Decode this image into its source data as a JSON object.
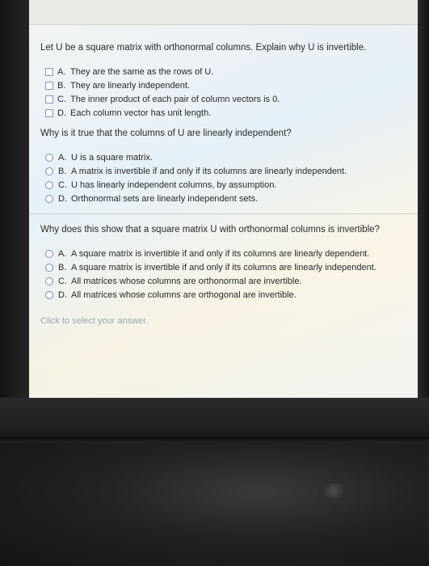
{
  "question1": {
    "text": "Let U be a square matrix with orthonormal columns. Explain why U is invertible.",
    "options": [
      {
        "letter": "A.",
        "text": "They are the same as the rows of U."
      },
      {
        "letter": "B.",
        "text": "They are linearly independent."
      },
      {
        "letter": "C.",
        "text": "The inner product of each pair of column vectors is 0."
      },
      {
        "letter": "D.",
        "text": "Each column vector has unit length."
      }
    ]
  },
  "question2": {
    "text": "Why is it true that the columns of U are linearly independent?",
    "options": [
      {
        "letter": "A.",
        "text": "U is a square matrix."
      },
      {
        "letter": "B.",
        "text": "A matrix is invertible if and only if its columns are linearly independent."
      },
      {
        "letter": "C.",
        "text": "U has linearly independent columns, by assumption."
      },
      {
        "letter": "D.",
        "text": "Orthonormal sets are linearly independent sets."
      }
    ]
  },
  "question3": {
    "text": "Why does this show that a square matrix U with orthonormal columns is invertible?",
    "options": [
      {
        "letter": "A.",
        "text": "A square matrix is invertible if and only if its columns are linearly dependent."
      },
      {
        "letter": "B.",
        "text": "A square matrix is invertible if and only if its columns are linearly independent."
      },
      {
        "letter": "C.",
        "text": "All matrices whose columns are orthonormal are invertible."
      },
      {
        "letter": "D.",
        "text": "All matrices whose columns are orthogonal are invertible."
      }
    ]
  },
  "hint": "Click to select your answer."
}
